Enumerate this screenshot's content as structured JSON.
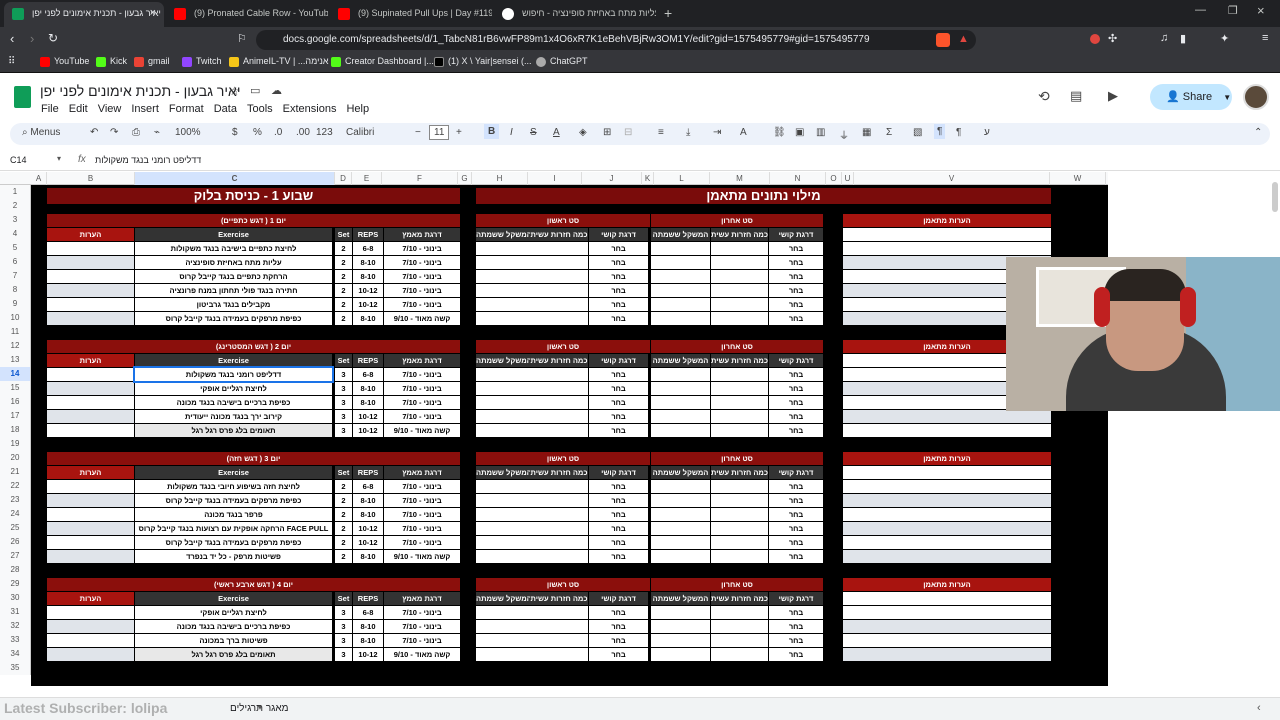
{
  "browser": {
    "tabs": [
      {
        "title": "יאיר גבעון - תכנית אימונים לפני יפן",
        "active": true
      },
      {
        "title": "(9) Pronated Cable Row - YouTube",
        "active": false
      },
      {
        "title": "(9) Supinated Pull Ups | Day #119 W",
        "active": false
      },
      {
        "title": "עליות מתח באחיזת סופינציה - חיפוש",
        "active": false
      }
    ],
    "url": "docs.google.com/spreadsheets/d/1_TabcN81rB6vwFP89m1x4O6xR7K1eBehVBjRw3OM1Y/edit?gid=1575495779#gid=1575495779",
    "bookmarks": [
      "YouTube",
      "Kick",
      "gmail",
      "Twitch",
      "AnimeIL-TV | ...אנימה",
      "Creator Dashboard |...",
      "(1) X \\ Yair|sensei (...",
      "ChatGPT"
    ]
  },
  "sheets": {
    "doc_title": "יאיר גבעון - תכנית אימונים לפני יפן",
    "menu": [
      "File",
      "Edit",
      "View",
      "Insert",
      "Format",
      "Data",
      "Tools",
      "Extensions",
      "Help"
    ],
    "share_label": "Share",
    "toolbar": {
      "menus": "Menus",
      "zoom": "100%",
      "currency": "$",
      "percent": "%",
      "decimals_down": ".0",
      "decimals_up": ".00",
      "number_fmt": "123",
      "font": "Calibri",
      "font_size": "11"
    },
    "name_box": "C14",
    "formula": "דדליפט רומני בנגד משקולות"
  },
  "grid": {
    "columns": [
      "A",
      "B",
      "C",
      "D",
      "E",
      "F",
      "G",
      "H",
      "I",
      "J",
      "K",
      "L",
      "M",
      "N",
      "O",
      "U",
      "V",
      "W"
    ],
    "rows": [
      "1",
      "2",
      "3",
      "4",
      "5",
      "6",
      "7",
      "8",
      "9",
      "10",
      "11",
      "12",
      "13",
      "14",
      "15",
      "16",
      "17",
      "18",
      "19",
      "20",
      "21",
      "22",
      "23",
      "24",
      "25",
      "26",
      "27",
      "28",
      "29",
      "30",
      "31",
      "32",
      "33",
      "34",
      "35"
    ],
    "week_title": "שבוע 1 - כניסת בלוק",
    "data_title": "מילוי נתונים מתאמן",
    "hdr": {
      "notes": "הערות",
      "exercise": "Exercise",
      "set": "Set",
      "reps": "REPS",
      "rpe": "דרגת מאמץ",
      "first_set": "סט ראשון",
      "last_set": "סט אחרון",
      "weight": "המשקל ששמתה",
      "reps_done": "כמה חזרות עשית",
      "difficulty": "דרגת קושי",
      "trainee_notes": "הערות מתאמן",
      "choose": "בחר"
    },
    "days": [
      {
        "title": "יום 1 ( דגש כתפיים)",
        "rows": [
          {
            "ex": "לחיצת כתפיים בישיבה בנגד משקולות",
            "set": "2",
            "reps": "6-8",
            "rpe": "בינוני - 7/10"
          },
          {
            "ex": "עליות מתח באחיזת סופינציה",
            "set": "2",
            "reps": "8-10",
            "rpe": "בינוני - 7/10"
          },
          {
            "ex": "הרחקת כתפיים בנגד קייבל קרוס",
            "set": "2",
            "reps": "8-10",
            "rpe": "בינוני - 7/10"
          },
          {
            "ex": "חתירה בנגד פולי תחתון במנח פרונציה",
            "set": "2",
            "reps": "10-12",
            "rpe": "בינוני - 7/10"
          },
          {
            "ex": "מקבילים בנגד גרביטון",
            "set": "2",
            "reps": "10-12",
            "rpe": "בינוני - 7/10"
          },
          {
            "ex": "כפיפת מרפקים בעמידה בנגד קייבל קרוס",
            "set": "2",
            "reps": "8-10",
            "rpe": "קשה מאוד - 9/10"
          }
        ]
      },
      {
        "title": "יום 2 ( דגש המסטרינג)",
        "rows": [
          {
            "ex": "דדליפט רומני בנגד משקולות",
            "set": "3",
            "reps": "6-8",
            "rpe": "בינוני - 7/10"
          },
          {
            "ex": "לחיצת רגליים אופקי",
            "set": "3",
            "reps": "8-10",
            "rpe": "בינוני - 7/10"
          },
          {
            "ex": "כפיפת ברכיים בישיבה בנגד מכונה",
            "set": "3",
            "reps": "8-10",
            "rpe": "בינוני - 7/10"
          },
          {
            "ex": "קירוב ירך בנגד מכונה ייעודית",
            "set": "3",
            "reps": "10-12",
            "rpe": "בינוני - 7/10"
          },
          {
            "ex": "תאומים בלג פרס רגל רגל",
            "set": "3",
            "reps": "10-12",
            "rpe": "קשה מאוד - 9/10"
          }
        ]
      },
      {
        "title": "יום 3 ( דגש חזה)",
        "rows": [
          {
            "ex": "לחיצת חזה בשיפוע חיובי בנגד משקולות",
            "set": "2",
            "reps": "6-8",
            "rpe": "בינוני - 7/10"
          },
          {
            "ex": "כפיפת מרפקים בעמידה בנגד קייבל קרוס",
            "set": "2",
            "reps": "8-10",
            "rpe": "בינוני - 7/10"
          },
          {
            "ex": "פרפר בנגד מכונה",
            "set": "2",
            "reps": "8-10",
            "rpe": "בינוני - 7/10"
          },
          {
            "ex": "FACE PULL הרחקה אופקית עם רצועות בנגד קייבל קרוס",
            "set": "2",
            "reps": "10-12",
            "rpe": "בינוני - 7/10"
          },
          {
            "ex": "כפיפת מרפקים בעמידה בנגד קייבל קרוס",
            "set": "2",
            "reps": "10-12",
            "rpe": "בינוני - 7/10"
          },
          {
            "ex": "פשיטות מרפק - כל יד בנפרד",
            "set": "2",
            "reps": "8-10",
            "rpe": "קשה מאוד - 9/10"
          }
        ]
      },
      {
        "title": "יום 4 ( דגש ארבע ראשי)",
        "rows": [
          {
            "ex": "לחיצת רגליים אופקי",
            "set": "3",
            "reps": "6-8",
            "rpe": "בינוני - 7/10"
          },
          {
            "ex": "כפיפת ברכיים בישיבה בנגד מכונה",
            "set": "3",
            "reps": "8-10",
            "rpe": "בינוני - 7/10"
          },
          {
            "ex": "פשיטות ברך במכונה",
            "set": "3",
            "reps": "8-10",
            "rpe": "בינוני - 7/10"
          },
          {
            "ex": "תאומים בלג פרס רגל רגל",
            "set": "3",
            "reps": "10-12",
            "rpe": "קשה מאוד - 9/10"
          }
        ]
      }
    ]
  },
  "sheet_tabs": [
    "מאגר תרגילים",
    "Latest Subscriber: lolipa"
  ]
}
